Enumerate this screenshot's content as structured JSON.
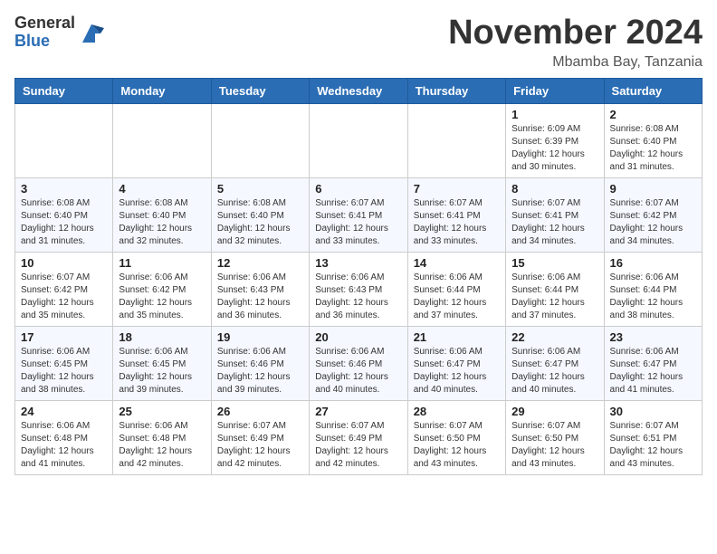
{
  "logo": {
    "general": "General",
    "blue": "Blue"
  },
  "header": {
    "month": "November 2024",
    "location": "Mbamba Bay, Tanzania"
  },
  "weekdays": [
    "Sunday",
    "Monday",
    "Tuesday",
    "Wednesday",
    "Thursday",
    "Friday",
    "Saturday"
  ],
  "weeks": [
    [
      {
        "day": "",
        "sunrise": "",
        "sunset": "",
        "daylight": ""
      },
      {
        "day": "",
        "sunrise": "",
        "sunset": "",
        "daylight": ""
      },
      {
        "day": "",
        "sunrise": "",
        "sunset": "",
        "daylight": ""
      },
      {
        "day": "",
        "sunrise": "",
        "sunset": "",
        "daylight": ""
      },
      {
        "day": "",
        "sunrise": "",
        "sunset": "",
        "daylight": ""
      },
      {
        "day": "1",
        "sunrise": "Sunrise: 6:09 AM",
        "sunset": "Sunset: 6:39 PM",
        "daylight": "Daylight: 12 hours and 30 minutes."
      },
      {
        "day": "2",
        "sunrise": "Sunrise: 6:08 AM",
        "sunset": "Sunset: 6:40 PM",
        "daylight": "Daylight: 12 hours and 31 minutes."
      }
    ],
    [
      {
        "day": "3",
        "sunrise": "Sunrise: 6:08 AM",
        "sunset": "Sunset: 6:40 PM",
        "daylight": "Daylight: 12 hours and 31 minutes."
      },
      {
        "day": "4",
        "sunrise": "Sunrise: 6:08 AM",
        "sunset": "Sunset: 6:40 PM",
        "daylight": "Daylight: 12 hours and 32 minutes."
      },
      {
        "day": "5",
        "sunrise": "Sunrise: 6:08 AM",
        "sunset": "Sunset: 6:40 PM",
        "daylight": "Daylight: 12 hours and 32 minutes."
      },
      {
        "day": "6",
        "sunrise": "Sunrise: 6:07 AM",
        "sunset": "Sunset: 6:41 PM",
        "daylight": "Daylight: 12 hours and 33 minutes."
      },
      {
        "day": "7",
        "sunrise": "Sunrise: 6:07 AM",
        "sunset": "Sunset: 6:41 PM",
        "daylight": "Daylight: 12 hours and 33 minutes."
      },
      {
        "day": "8",
        "sunrise": "Sunrise: 6:07 AM",
        "sunset": "Sunset: 6:41 PM",
        "daylight": "Daylight: 12 hours and 34 minutes."
      },
      {
        "day": "9",
        "sunrise": "Sunrise: 6:07 AM",
        "sunset": "Sunset: 6:42 PM",
        "daylight": "Daylight: 12 hours and 34 minutes."
      }
    ],
    [
      {
        "day": "10",
        "sunrise": "Sunrise: 6:07 AM",
        "sunset": "Sunset: 6:42 PM",
        "daylight": "Daylight: 12 hours and 35 minutes."
      },
      {
        "day": "11",
        "sunrise": "Sunrise: 6:06 AM",
        "sunset": "Sunset: 6:42 PM",
        "daylight": "Daylight: 12 hours and 35 minutes."
      },
      {
        "day": "12",
        "sunrise": "Sunrise: 6:06 AM",
        "sunset": "Sunset: 6:43 PM",
        "daylight": "Daylight: 12 hours and 36 minutes."
      },
      {
        "day": "13",
        "sunrise": "Sunrise: 6:06 AM",
        "sunset": "Sunset: 6:43 PM",
        "daylight": "Daylight: 12 hours and 36 minutes."
      },
      {
        "day": "14",
        "sunrise": "Sunrise: 6:06 AM",
        "sunset": "Sunset: 6:44 PM",
        "daylight": "Daylight: 12 hours and 37 minutes."
      },
      {
        "day": "15",
        "sunrise": "Sunrise: 6:06 AM",
        "sunset": "Sunset: 6:44 PM",
        "daylight": "Daylight: 12 hours and 37 minutes."
      },
      {
        "day": "16",
        "sunrise": "Sunrise: 6:06 AM",
        "sunset": "Sunset: 6:44 PM",
        "daylight": "Daylight: 12 hours and 38 minutes."
      }
    ],
    [
      {
        "day": "17",
        "sunrise": "Sunrise: 6:06 AM",
        "sunset": "Sunset: 6:45 PM",
        "daylight": "Daylight: 12 hours and 38 minutes."
      },
      {
        "day": "18",
        "sunrise": "Sunrise: 6:06 AM",
        "sunset": "Sunset: 6:45 PM",
        "daylight": "Daylight: 12 hours and 39 minutes."
      },
      {
        "day": "19",
        "sunrise": "Sunrise: 6:06 AM",
        "sunset": "Sunset: 6:46 PM",
        "daylight": "Daylight: 12 hours and 39 minutes."
      },
      {
        "day": "20",
        "sunrise": "Sunrise: 6:06 AM",
        "sunset": "Sunset: 6:46 PM",
        "daylight": "Daylight: 12 hours and 40 minutes."
      },
      {
        "day": "21",
        "sunrise": "Sunrise: 6:06 AM",
        "sunset": "Sunset: 6:47 PM",
        "daylight": "Daylight: 12 hours and 40 minutes."
      },
      {
        "day": "22",
        "sunrise": "Sunrise: 6:06 AM",
        "sunset": "Sunset: 6:47 PM",
        "daylight": "Daylight: 12 hours and 40 minutes."
      },
      {
        "day": "23",
        "sunrise": "Sunrise: 6:06 AM",
        "sunset": "Sunset: 6:47 PM",
        "daylight": "Daylight: 12 hours and 41 minutes."
      }
    ],
    [
      {
        "day": "24",
        "sunrise": "Sunrise: 6:06 AM",
        "sunset": "Sunset: 6:48 PM",
        "daylight": "Daylight: 12 hours and 41 minutes."
      },
      {
        "day": "25",
        "sunrise": "Sunrise: 6:06 AM",
        "sunset": "Sunset: 6:48 PM",
        "daylight": "Daylight: 12 hours and 42 minutes."
      },
      {
        "day": "26",
        "sunrise": "Sunrise: 6:07 AM",
        "sunset": "Sunset: 6:49 PM",
        "daylight": "Daylight: 12 hours and 42 minutes."
      },
      {
        "day": "27",
        "sunrise": "Sunrise: 6:07 AM",
        "sunset": "Sunset: 6:49 PM",
        "daylight": "Daylight: 12 hours and 42 minutes."
      },
      {
        "day": "28",
        "sunrise": "Sunrise: 6:07 AM",
        "sunset": "Sunset: 6:50 PM",
        "daylight": "Daylight: 12 hours and 43 minutes."
      },
      {
        "day": "29",
        "sunrise": "Sunrise: 6:07 AM",
        "sunset": "Sunset: 6:50 PM",
        "daylight": "Daylight: 12 hours and 43 minutes."
      },
      {
        "day": "30",
        "sunrise": "Sunrise: 6:07 AM",
        "sunset": "Sunset: 6:51 PM",
        "daylight": "Daylight: 12 hours and 43 minutes."
      }
    ]
  ]
}
